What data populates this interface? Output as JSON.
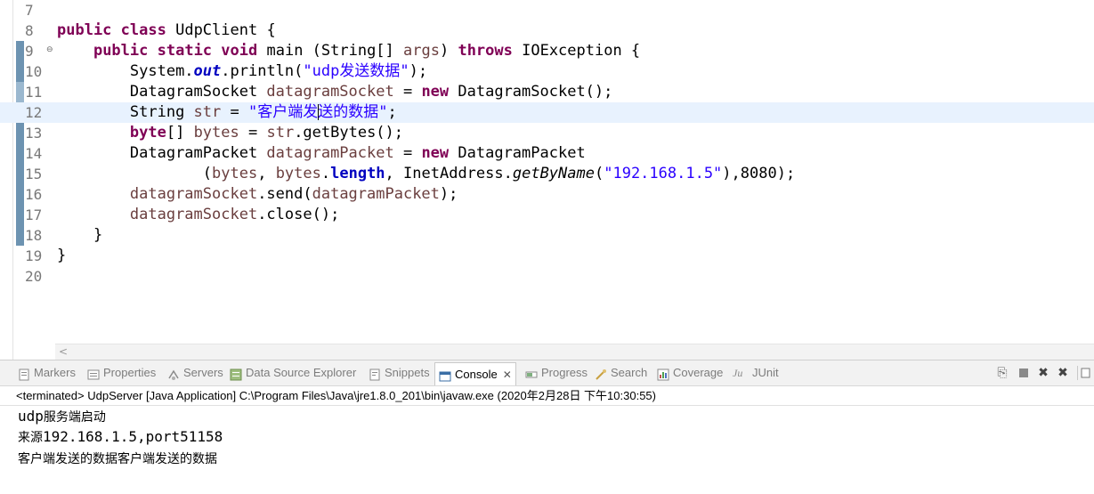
{
  "editor": {
    "lines": [
      {
        "num": "7"
      },
      {
        "num": "8"
      },
      {
        "num": "9"
      },
      {
        "num": "10"
      },
      {
        "num": "11"
      },
      {
        "num": "12"
      },
      {
        "num": "13"
      },
      {
        "num": "14"
      },
      {
        "num": "15"
      },
      {
        "num": "16"
      },
      {
        "num": "17"
      },
      {
        "num": "18"
      },
      {
        "num": "19"
      },
      {
        "num": "20"
      }
    ],
    "tokens": {
      "public": "public",
      "class": "class",
      "classname": " UdpClient {",
      "static": "static",
      "void": "void",
      "main_sig": " main (String[] ",
      "args": "args",
      "throws": "throws",
      "ioexc": " IOException {",
      "system": "System.",
      "out": "out",
      "println": ".println(",
      "str1": "\"udp发送数据\"",
      "close_paren_semi": ");",
      "dgs_type": "DatagramSocket ",
      "dgs_var": "datagramSocket",
      "assign": " = ",
      "new": "new",
      "dgs_ctor": " DatagramSocket();",
      "string_type": "String ",
      "str_var": "str",
      "str2_a": "\"客户端发",
      "str2_b": "送的数据\"",
      "semi": ";",
      "byte": "byte",
      "bytes_decl": "[] ",
      "bytes_var": "bytes",
      "getbytes": ".getBytes();",
      "dgp_type": "DatagramPacket ",
      "dgp_var": "datagramPacket",
      "dgp_ctor": " DatagramPacket",
      "open_paren": "(",
      "comma_sp": ", ",
      "dot": ".",
      "length": "length",
      "inet": "InetAddress.",
      "getbyname": "getByName",
      "ip": "\"192.168.1.5\"",
      "port_tail": "),8080);",
      "send": ".send(",
      "close_call": ".close();",
      "brace_close": "}"
    }
  },
  "console_view": {
    "tabs": [
      {
        "label": "Markers",
        "icon": "markers-icon"
      },
      {
        "label": "Properties",
        "icon": "properties-icon"
      },
      {
        "label": "Servers",
        "icon": "servers-icon"
      },
      {
        "label": "Data Source Explorer",
        "icon": "data-source-icon"
      },
      {
        "label": "Snippets",
        "icon": "snippets-icon"
      },
      {
        "label": "Console",
        "icon": "console-icon",
        "active": true
      },
      {
        "label": "Progress",
        "icon": "progress-icon"
      },
      {
        "label": "Search",
        "icon": "search-icon"
      },
      {
        "label": "Coverage",
        "icon": "coverage-icon"
      },
      {
        "label": "JUnit",
        "icon": "junit-icon"
      }
    ],
    "close_glyph": "✕",
    "status": "<terminated> UdpServer [Java Application] C:\\Program Files\\Java\\jre1.8.0_201\\bin\\javaw.exe (2020年2月28日 下午10:30:55)",
    "output": {
      "line1_a": "udp",
      "line1_b": "服务端启动",
      "line2_a": "来源",
      "line2_b": "192.168.1.5,port51158",
      "line3": "客户端发送的数据客户端发送的数据"
    }
  },
  "colors": {
    "keyword": "#7f0055",
    "string": "#2a00ff",
    "field": "#0000c0",
    "local_var": "#6a3e3e",
    "current_line": "#e8f2fe",
    "quick_diff": "#6d93b1"
  }
}
